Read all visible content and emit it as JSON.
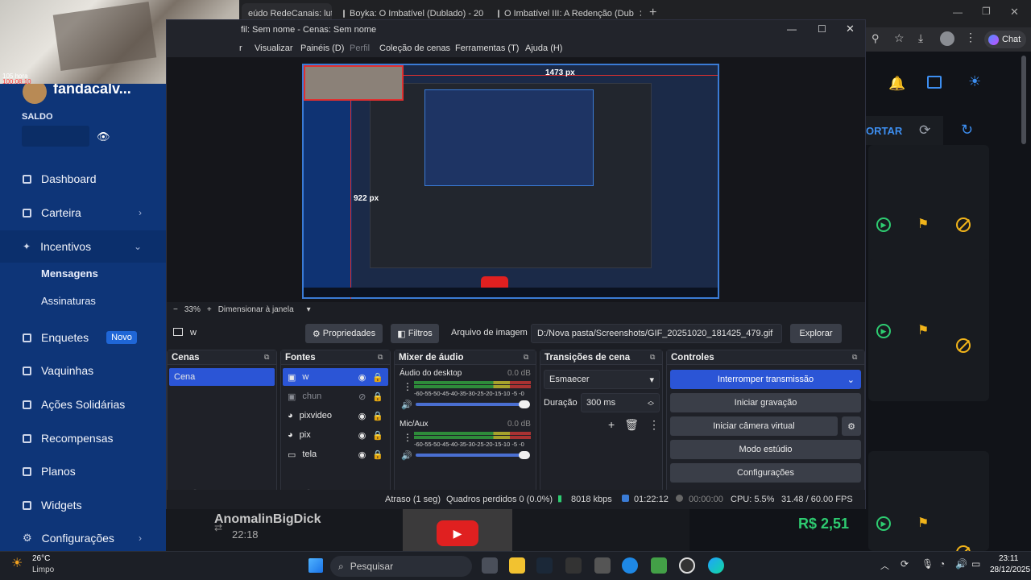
{
  "browser": {
    "tabs": [
      {
        "label": "eúdo RedeCanais: lut"
      },
      {
        "label": "Boyka: O Imbatível (Dublado) - 20"
      },
      {
        "label": "O Imbatível III: A Redenção (Dub"
      }
    ],
    "new_tab": "+",
    "chat_label": "Chat"
  },
  "webcam": {
    "overlay_text1": "105 hora",
    "overlay_text2": "100:08:10"
  },
  "sidebar": {
    "username": "fandacalv...",
    "balance_label": "SALDO",
    "items": [
      {
        "label": "Dashboard"
      },
      {
        "label": "Carteira"
      },
      {
        "label": "Incentivos"
      },
      {
        "label": "Mensagens"
      },
      {
        "label": "Assinaturas"
      },
      {
        "label": "Enquetes",
        "badge": "Novo"
      },
      {
        "label": "Vaquinhas"
      },
      {
        "label": "Ações Solidárias"
      },
      {
        "label": "Recompensas"
      },
      {
        "label": "Planos"
      },
      {
        "label": "Widgets"
      },
      {
        "label": "Configurações"
      }
    ]
  },
  "rightcol": {
    "button_text": "ORTAR"
  },
  "obs": {
    "title": "fil: Sem nome - Cenas: Sem nome",
    "menu": [
      "r",
      "Visualizar",
      "Painéis (D)",
      "Perfil",
      "Coleção de cenas",
      "Ferramentas (T)",
      "Ajuda (H)"
    ],
    "preview": {
      "measure_h": "1473 px",
      "measure_v": "922 px"
    },
    "zoom": {
      "minus": "−",
      "value": "33%",
      "plus": "+",
      "mode": "Dimensionar à janela"
    },
    "source_bar": {
      "name": "w",
      "properties": "Propriedades",
      "filters": "Filtros",
      "image_file_label": "Arquivo de imagem",
      "path": "D:/Nova pasta/Screenshots/GIF_20251020_181425_479.gif",
      "browse": "Explorar"
    },
    "scenes": {
      "title": "Cenas",
      "items": [
        "Cena"
      ]
    },
    "sources": {
      "title": "Fontes",
      "items": [
        "w",
        "chun",
        "pixvideo",
        "pix",
        "tela"
      ]
    },
    "mixer": {
      "title": "Mixer de áudio",
      "channels": [
        {
          "name": "Áudio do desktop",
          "db": "0.0 dB"
        },
        {
          "name": "Mic/Aux",
          "db": "0.0 dB"
        }
      ],
      "scale": "-60-55-50-45-40-35-30-25-20-15-10 -5 -0"
    },
    "transitions": {
      "title": "Transições de cena",
      "selected": "Esmaecer",
      "duration_label": "Duração",
      "duration_value": "300 ms"
    },
    "controls": {
      "title": "Controles",
      "buttons": [
        "Interromper transmissão",
        "Iniciar gravação",
        "Iniciar câmera virtual",
        "Modo estúdio",
        "Configurações"
      ]
    },
    "status": {
      "delay": "Atraso (1 seg)",
      "dropped": "Quadros perdidos 0 (0.0%)",
      "bitrate": "8018 kbps",
      "stream_time": "01:22:12",
      "rec_time": "00:00:00",
      "cpu": "CPU: 5.5%",
      "fps": "31.48 / 60.00 FPS"
    }
  },
  "background_site": {
    "donor_name": "AnomalinBigDick",
    "donor_time": "22:18",
    "amount": "R$ 2,51"
  },
  "taskbar": {
    "weather_temp": "26°C",
    "weather_desc": "Limpo",
    "search": "Pesquisar",
    "time": "23:11",
    "date": "28/12/2025"
  },
  "colors": {
    "sidebar": "#0e3578",
    "accent_blue": "#2b55d6",
    "green": "#2ecc71",
    "gold": "#f1b41a"
  }
}
